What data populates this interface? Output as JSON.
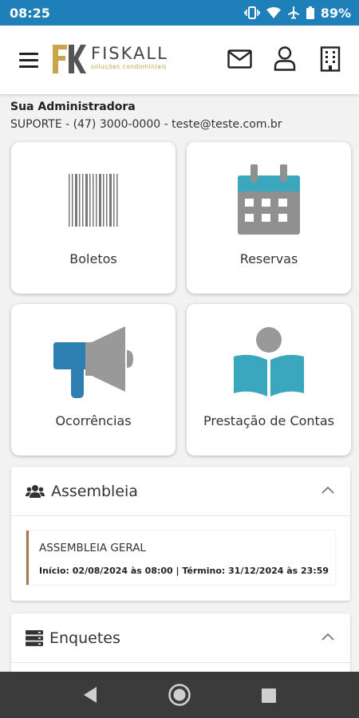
{
  "statusbar": {
    "time": "08:25",
    "battery": "89%"
  },
  "header": {
    "logo_name": "FISKALL",
    "logo_sub": "soluções condominiais"
  },
  "admin": {
    "title": "Sua Administradora",
    "contact": "SUPORTE - (47) 3000-0000 - teste@teste.com.br"
  },
  "tiles": [
    {
      "label": "Boletos",
      "icon": "barcode-icon"
    },
    {
      "label": "Reservas",
      "icon": "calendar-icon"
    },
    {
      "label": "Ocorrências",
      "icon": "megaphone-icon"
    },
    {
      "label": "Prestação de Contas",
      "icon": "book-reader-icon"
    }
  ],
  "assembleia": {
    "title": "Assembleia",
    "item_title": "ASSEMBLEIA GERAL",
    "item_dates": "Início: 02/08/2024 às 08:00 | Término: 31/12/2024 às 23:59"
  },
  "enquetes": {
    "title": "Enquetes"
  },
  "colors": {
    "statusbar": "#1f7fb8",
    "accent_teal": "#3a9ab8",
    "accent_gold": "#c9a44a",
    "item_border": "#a5784a",
    "navbar": "#3b3b3b"
  }
}
